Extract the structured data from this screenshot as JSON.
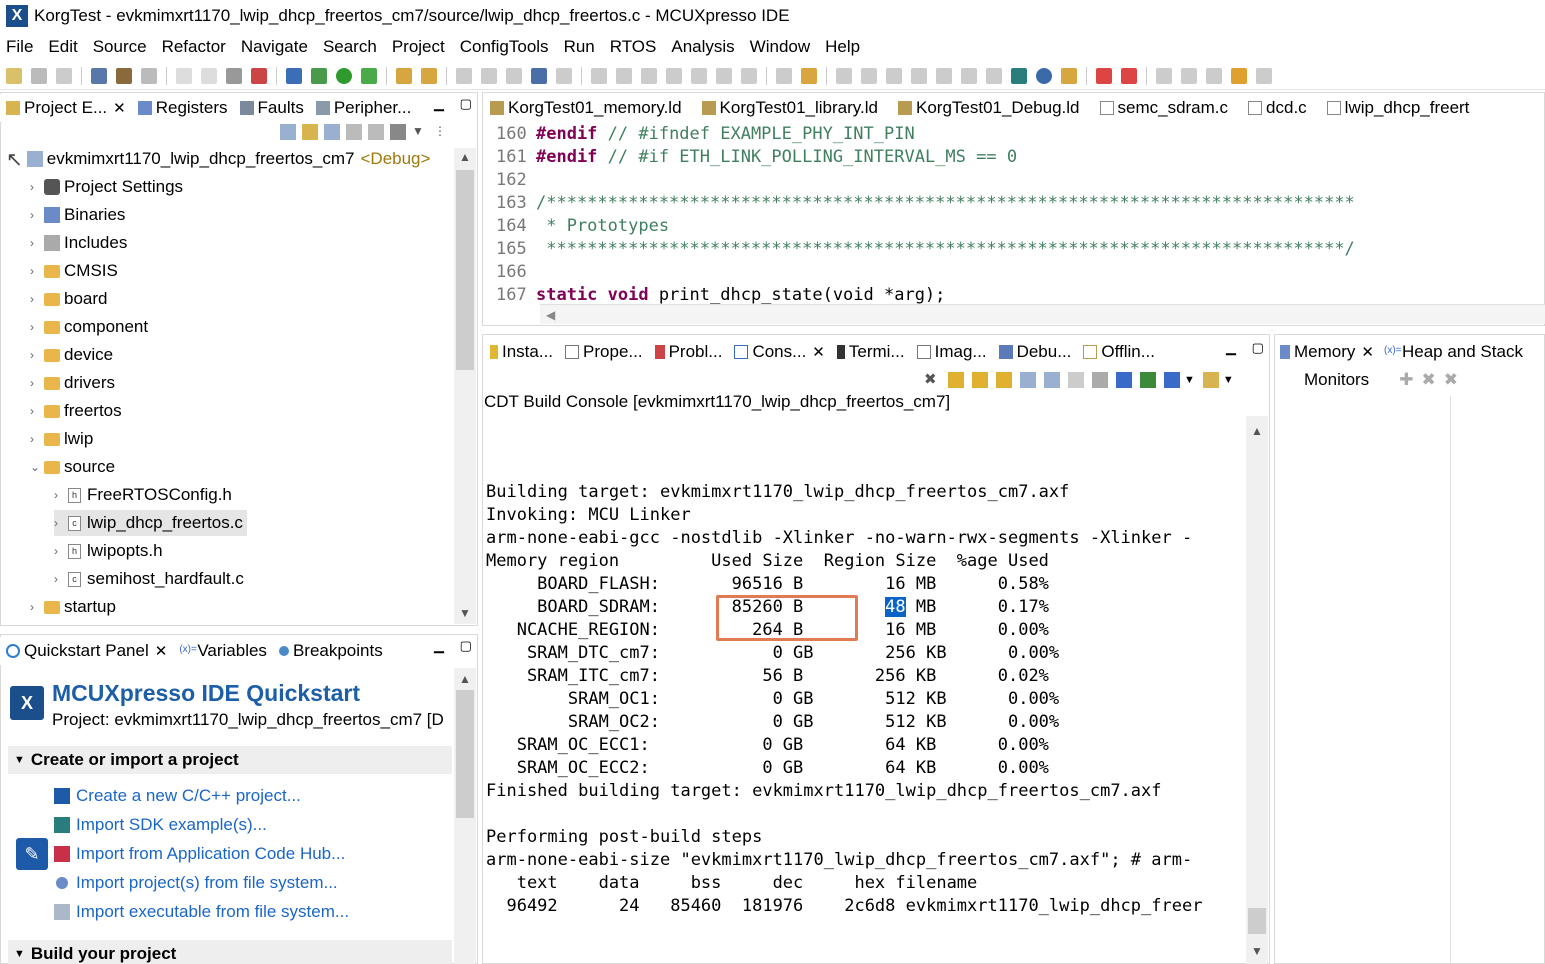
{
  "window": {
    "title": "KorgTest - evkmimxrt1170_lwip_dhcp_freertos_cm7/source/lwip_dhcp_freertos.c - MCUXpresso IDE",
    "app_icon": "X"
  },
  "menu": [
    "File",
    "Edit",
    "Source",
    "Refactor",
    "Navigate",
    "Search",
    "Project",
    "ConfigTools",
    "Run",
    "RTOS",
    "Analysis",
    "Window",
    "Help"
  ],
  "project_explorer": {
    "tabs": [
      {
        "label": "Project E...",
        "icon": "project-explorer-icon",
        "close": "✕"
      },
      {
        "label": "Registers",
        "icon": "registers-icon"
      },
      {
        "label": "Faults",
        "icon": "faults-icon"
      },
      {
        "label": "Peripher...",
        "icon": "peripherals-icon"
      }
    ],
    "root": {
      "label": "evkmimxrt1170_lwip_dhcp_freertos_cm7",
      "tag": "<Debug>"
    },
    "items": [
      {
        "label": "Project Settings",
        "type": "settings"
      },
      {
        "label": "Binaries",
        "type": "binaries"
      },
      {
        "label": "Includes",
        "type": "includes"
      },
      {
        "label": "CMSIS",
        "type": "folder"
      },
      {
        "label": "board",
        "type": "folder"
      },
      {
        "label": "component",
        "type": "folder"
      },
      {
        "label": "device",
        "type": "folder"
      },
      {
        "label": "drivers",
        "type": "folder"
      },
      {
        "label": "freertos",
        "type": "folder"
      },
      {
        "label": "lwip",
        "type": "folder"
      },
      {
        "label": "source",
        "type": "folder-open"
      },
      {
        "label": "FreeRTOSConfig.h",
        "type": "h"
      },
      {
        "label": "lwip_dhcp_freertos.c",
        "type": "c"
      },
      {
        "label": "lwipopts.h",
        "type": "h"
      },
      {
        "label": "semihost_hardfault.c",
        "type": "c"
      },
      {
        "label": "startup",
        "type": "folder"
      }
    ]
  },
  "quickstart": {
    "tabs": [
      {
        "label": "Quickstart Panel",
        "close": "✕"
      },
      {
        "label": "Variables"
      },
      {
        "label": "Breakpoints"
      }
    ],
    "title": "MCUXpresso IDE Quickstart",
    "project_line": "Project: evkmimxrt1170_lwip_dhcp_freertos_cm7 [D",
    "section_create": "Create or import a project",
    "links": [
      "Create a new C/C++ project...",
      "Import SDK example(s)...",
      "Import from Application Code Hub...",
      "Import project(s) from file system...",
      "Import executable from file system..."
    ],
    "section_build": "Build your project"
  },
  "editor": {
    "tabs": [
      {
        "label": "KorgTest01_memory.ld"
      },
      {
        "label": "KorgTest01_library.ld"
      },
      {
        "label": "KorgTest01_Debug.ld"
      },
      {
        "label": "semc_sdram.c"
      },
      {
        "label": "dcd.c"
      },
      {
        "label": "lwip_dhcp_freert"
      }
    ],
    "lines": [
      {
        "n": "160",
        "pre": "#endif",
        "cm": " // #ifndef EXAMPLE_PHY_INT_PIN"
      },
      {
        "n": "161",
        "pre": "#endif",
        "cm": " // #if ETH_LINK_POLLING_INTERVAL_MS == 0"
      },
      {
        "n": "162",
        "pre": "",
        "cm": ""
      },
      {
        "n": "163",
        "pre": "",
        "cm": "/*******************************************************************************"
      },
      {
        "n": "164",
        "pre": "",
        "cm": " * Prototypes"
      },
      {
        "n": "165",
        "pre": "",
        "cm": " ******************************************************************************/"
      },
      {
        "n": "166",
        "pre": "",
        "cm": ""
      },
      {
        "n": "167",
        "pre": "static void",
        "cm": " print_dhcp_state(void *arg);"
      }
    ]
  },
  "console": {
    "tabs": [
      {
        "label": "Insta..."
      },
      {
        "label": "Prope..."
      },
      {
        "label": "Probl..."
      },
      {
        "label": "Cons...",
        "close": "✕"
      },
      {
        "label": "Termi..."
      },
      {
        "label": "Imag..."
      },
      {
        "label": "Debu..."
      },
      {
        "label": "Offlin..."
      }
    ],
    "title": "CDT Build Console [evkmimxrt1170_lwip_dhcp_freertos_cm7]",
    "lines": [
      "Building target: evkmimxrt1170_lwip_dhcp_freertos_cm7.axf",
      "Invoking: MCU Linker",
      "arm-none-eabi-gcc -nostdlib -Xlinker -no-warn-rwx-segments -Xlinker -",
      "Memory region         Used Size  Region Size  %age Used",
      "     BOARD_FLASH:       96516 B        16 MB      0.58%",
      "     BOARD_SDRAM:       85260 B        ",
      "   NCACHE_REGION:         264 B        16 MB      0.00%",
      "    SRAM_DTC_cm7:           0 GB       256 KB      0.00%",
      "    SRAM_ITC_cm7:          56 B       256 KB      0.02%",
      "        SRAM_OC1:           0 GB       512 KB      0.00%",
      "        SRAM_OC2:           0 GB       512 KB      0.00%",
      "   SRAM_OC_ECC1:           0 GB        64 KB      0.00%",
      "   SRAM_OC_ECC2:           0 GB        64 KB      0.00%",
      "Finished building target: evkmimxrt1170_lwip_dhcp_freertos_cm7.axf",
      "",
      "Performing post-build steps",
      "arm-none-eabi-size \"evkmimxrt1170_lwip_dhcp_freertos_cm7.axf\"; # arm-",
      "   text    data     bss     dec     hex filename",
      "  96492      24   85460  181976    2c6d8 evkmimxrt1170_lwip_dhcp_freer"
    ],
    "sdram_selected": "48",
    "sdram_rest": " MB      0.17%"
  },
  "memory_panel": {
    "tabs": [
      {
        "label": "Memory",
        "close": "✕"
      },
      {
        "label": "Heap and Stack"
      }
    ],
    "monitors_label": "Monitors"
  },
  "colors": {
    "accent": "#1c5fa8",
    "link": "#1a66c7",
    "highlight_box": "#e07b53",
    "selection": "#0a64c8"
  }
}
